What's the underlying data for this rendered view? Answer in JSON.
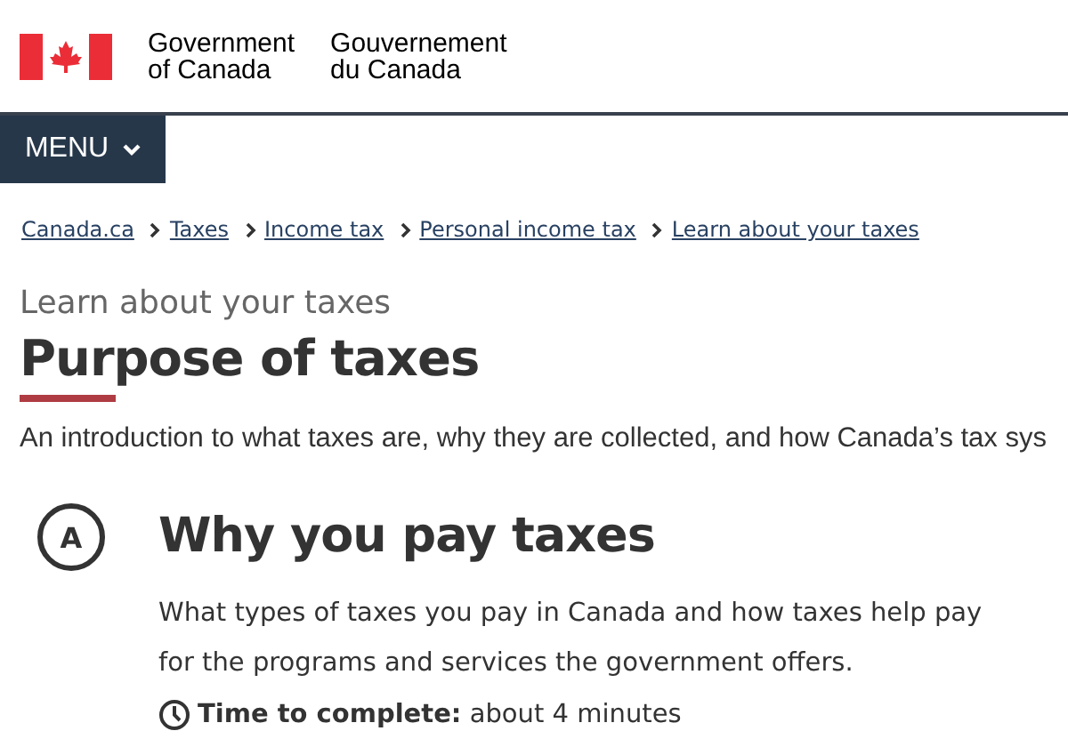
{
  "header": {
    "signature_en": [
      "Government",
      "of Canada"
    ],
    "signature_fr": [
      "Gouvernement",
      "du Canada"
    ]
  },
  "menu": {
    "label": "MENU"
  },
  "breadcrumbs": [
    "Canada.ca",
    "Taxes",
    "Income tax",
    "Personal income tax",
    "Learn about your taxes"
  ],
  "page": {
    "kicker": "Learn about your taxes",
    "title": "Purpose of taxes",
    "intro": "An introduction to what taxes are, why they are collected, and how Canada’s tax sys"
  },
  "steps": [
    {
      "letter": "A",
      "title": "Why you pay taxes",
      "description": "What types of taxes you pay in Canada and how taxes help pay for the programs and services the government offers.",
      "time": "**Time to complete:** about 4 minutes"
    }
  ]
}
